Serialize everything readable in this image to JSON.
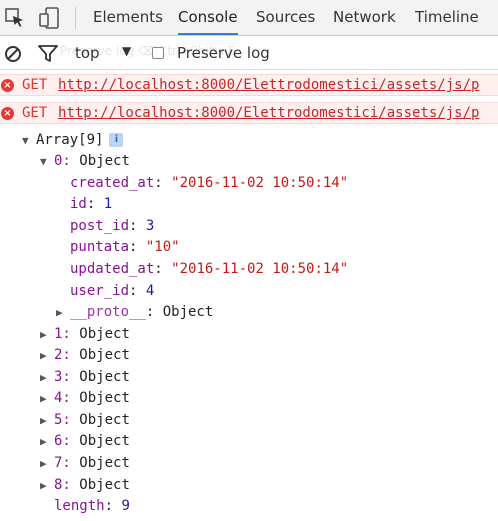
{
  "tabs": [
    "Elements",
    "Console",
    "Sources",
    "Network",
    "Timeline"
  ],
  "active_tab": "Console",
  "toolbar": {
    "context": "top",
    "preserve_log_label": "Preserve log",
    "ghost_text": "Preserve log     ⌫   Ctrl+Shift+E"
  },
  "errors": [
    {
      "method": "GET",
      "url": "http://localhost:8000/Elettrodomestici/assets/js/p"
    },
    {
      "method": "GET",
      "url": "http://localhost:8000/Elettrodomestici/assets/js/p"
    }
  ],
  "array": {
    "header": "Array[9]",
    "info_badge": "i",
    "item0_label": "0:",
    "item0_type": "Object",
    "fields": [
      {
        "key": "created_at",
        "value": "\"2016-11-02 10:50:14\"",
        "kind": "str"
      },
      {
        "key": "id",
        "value": "1",
        "kind": "num"
      },
      {
        "key": "post_id",
        "value": "3",
        "kind": "num"
      },
      {
        "key": "puntata",
        "value": "\"10\"",
        "kind": "str"
      },
      {
        "key": "updated_at",
        "value": "\"2016-11-02 10:50:14\"",
        "kind": "str"
      },
      {
        "key": "user_id",
        "value": "4",
        "kind": "num"
      }
    ],
    "proto_key": "__proto__",
    "proto_value": "Object",
    "items": [
      {
        "label": "1:",
        "type": "Object"
      },
      {
        "label": "2:",
        "type": "Object"
      },
      {
        "label": "3:",
        "type": "Object"
      },
      {
        "label": "4:",
        "type": "Object"
      },
      {
        "label": "5:",
        "type": "Object"
      },
      {
        "label": "6:",
        "type": "Object"
      },
      {
        "label": "7:",
        "type": "Object"
      },
      {
        "label": "8:",
        "type": "Object"
      }
    ],
    "length_key": "length",
    "length_value": "9"
  }
}
